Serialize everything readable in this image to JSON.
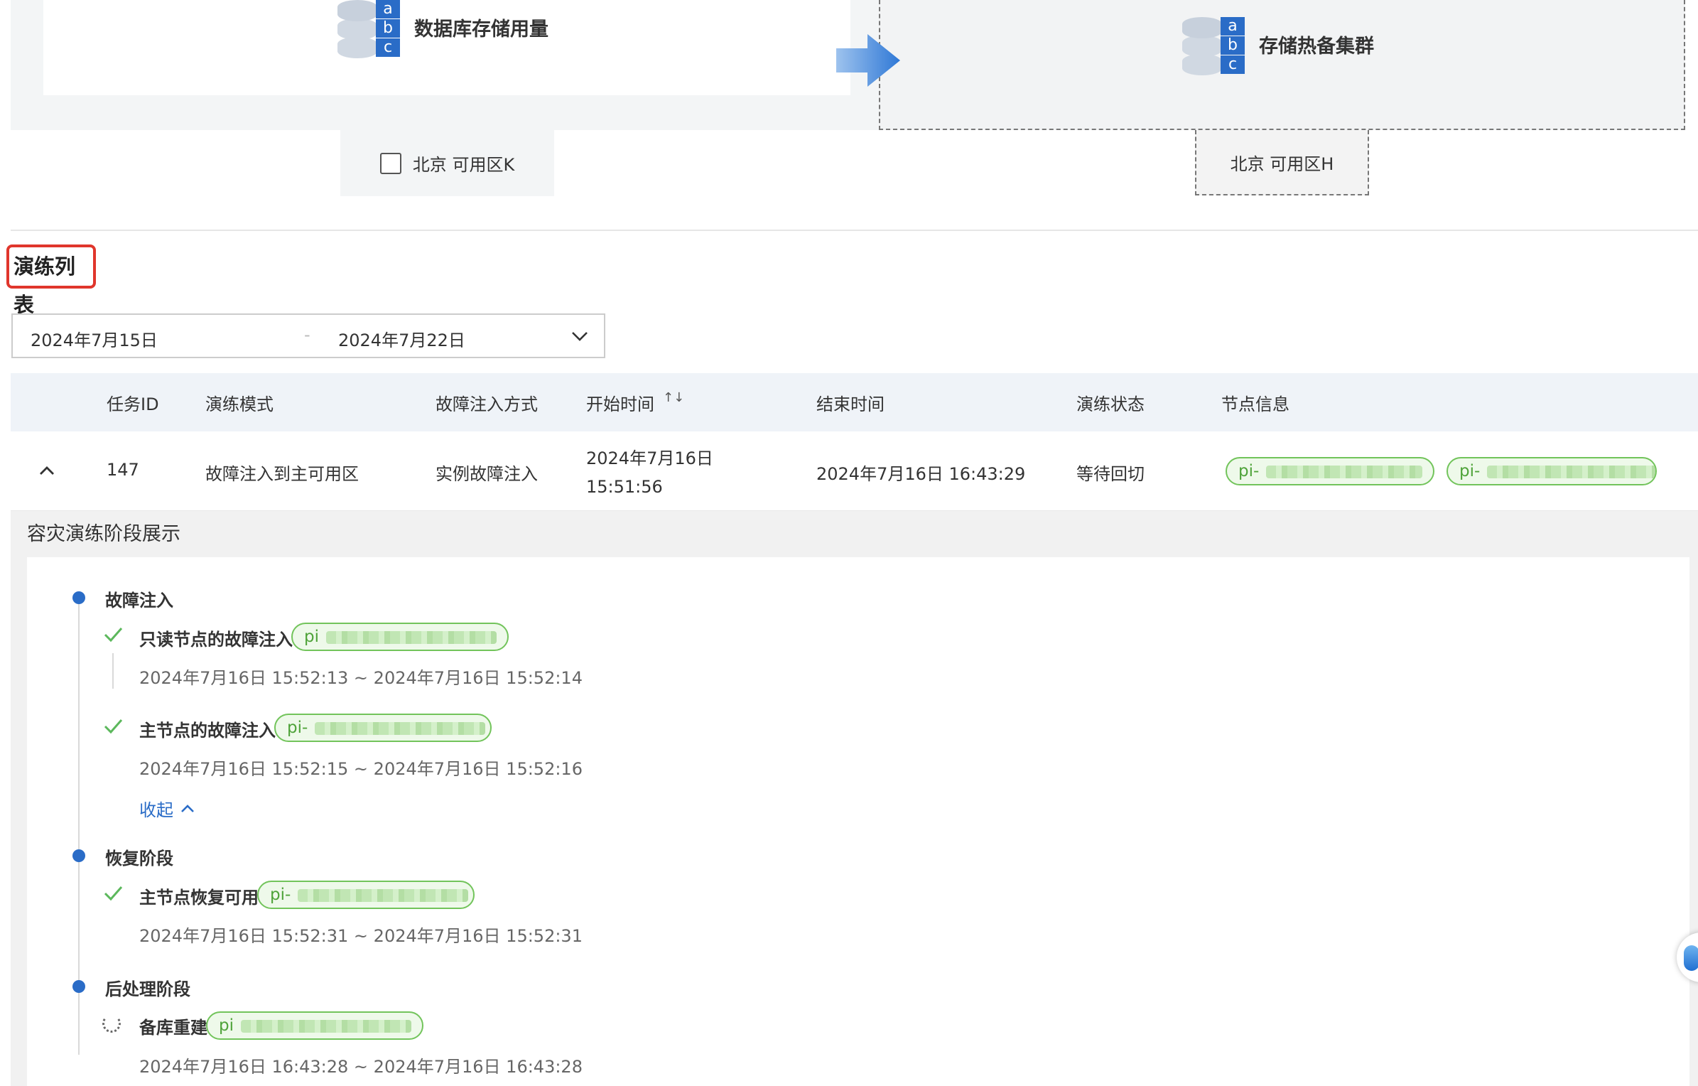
{
  "topology": {
    "primary_db_label": "数据库存储用量",
    "standby_db_label": "存储热备集群",
    "zone_primary": "北京 可用区K",
    "zone_standby": "北京 可用区H",
    "abc": [
      "a",
      "b",
      "c"
    ]
  },
  "section": {
    "title": "演练列表"
  },
  "date_range": {
    "start": "2024年7月15日",
    "separator": "-",
    "end": "2024年7月22日"
  },
  "table": {
    "headers": {
      "task_id": "任务ID",
      "mode": "演练模式",
      "injection": "故障注入方式",
      "start_time": "开始时间",
      "end_time": "结束时间",
      "status": "演练状态",
      "nodes": "节点信息"
    },
    "sort_icon": "↑↓",
    "row": {
      "task_id": "147",
      "mode": "故障注入到主可用区",
      "injection": "实例故障注入",
      "start_date": "2024年7月16日",
      "start_clock": "15:51:56",
      "end_time": "2024年7月16日 16:43:29",
      "status": "等待回切",
      "node_tags": [
        "pi-",
        "pi-"
      ]
    }
  },
  "stages": {
    "title": "容灾演练阶段展示",
    "phase_fault": "故障注入",
    "step_readonly": "只读节点的故障注入",
    "step_readonly_tag": "pi",
    "step_readonly_time": "2024年7月16日 15:52:13 ~ 2024年7月16日 15:52:14",
    "step_primary": "主节点的故障注入",
    "step_primary_tag": "pi-",
    "step_primary_time": "2024年7月16日 15:52:15 ~ 2024年7月16日 15:52:16",
    "collapse": "收起",
    "phase_recover": "恢复阶段",
    "step_recover": "主节点恢复可用",
    "step_recover_tag": "pi-",
    "step_recover_time": "2024年7月16日 15:52:31 ~ 2024年7月16日 15:52:31",
    "phase_post": "后处理阶段",
    "step_rebuild": "备库重建",
    "step_rebuild_tag": "pi",
    "step_rebuild_time": "2024年7月16日 16:43:28 ~ 2024年7月16日 16:43:28"
  },
  "colors": {
    "accent": "#2a6cc7",
    "tag_green": "#72c45b",
    "highlight_red": "#e0362c"
  }
}
